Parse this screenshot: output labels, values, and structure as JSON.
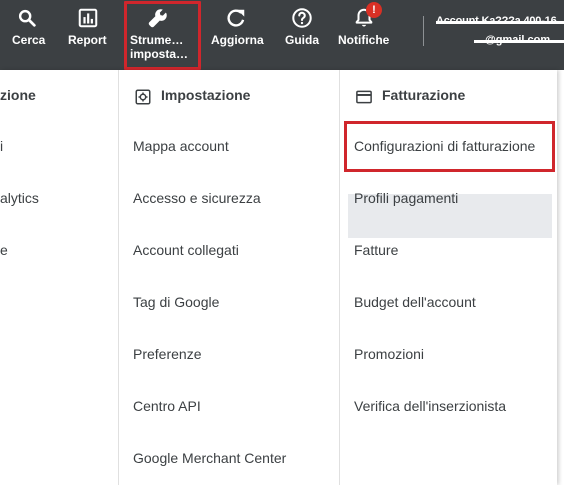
{
  "toolbar": {
    "search_label": "Cerca",
    "reports_label": "Report",
    "tools_label_line1": "Strume…",
    "tools_label_line2": "imposta…",
    "refresh_label": "Aggiorna",
    "help_label": "Guida",
    "notifications_label": "Notifiche",
    "notifications_badge": "!",
    "account_name": "Account Ka???a 400-16",
    "account_email": "…@gmail.com"
  },
  "menu": {
    "left_column": {
      "header": "zione",
      "items": [
        "i",
        "alytics",
        "e"
      ]
    },
    "setup_column": {
      "header": "Impostazione",
      "icon": "gear-icon",
      "items": [
        "Mappa account",
        "Accesso e sicurezza",
        "Account collegati",
        "Tag di Google",
        "Preferenze",
        "Centro API",
        "Google Merchant Center"
      ]
    },
    "billing_column": {
      "header": "Fatturazione",
      "icon": "credit-card-icon",
      "items": [
        "Configurazioni di fatturazione",
        "Profili pagamenti",
        "Fatture",
        "Budget dell'account",
        "Promozioni",
        "Verifica dell'inserzionista"
      ]
    }
  },
  "colors": {
    "toolbar_bg": "#3c4043",
    "highlight_red": "#d0262c",
    "notification_red": "#d93025",
    "selected_item_bg": "#e8eaed",
    "text": "#3c4043"
  }
}
